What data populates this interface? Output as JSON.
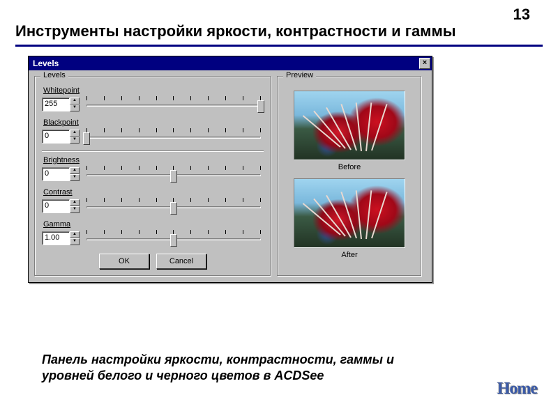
{
  "page": {
    "number": "13",
    "title": "Инструменты настройки яркости, контрастности и гаммы",
    "caption": "Панель настройки яркости, контрастности, гаммы и уровней белого и черного цветов в ACDSee",
    "home": "Home"
  },
  "dialog": {
    "title": "Levels",
    "close": "×",
    "levels_group_label": "Levels",
    "preview_group_label": "Preview",
    "sliders": {
      "whitepoint": {
        "label": "Whitepoint",
        "value": "255",
        "pos_pct": 100
      },
      "blackpoint": {
        "label": "Blackpoint",
        "value": "0",
        "pos_pct": 0
      },
      "brightness": {
        "label": "Brightness",
        "value": "0",
        "pos_pct": 50
      },
      "contrast": {
        "label": "Contrast",
        "value": "0",
        "pos_pct": 50
      },
      "gamma": {
        "label": "Gamma",
        "value": "1.00",
        "pos_pct": 50
      }
    },
    "buttons": {
      "ok": "OK",
      "cancel": "Cancel"
    },
    "preview": {
      "before": "Before",
      "after": "After"
    }
  }
}
